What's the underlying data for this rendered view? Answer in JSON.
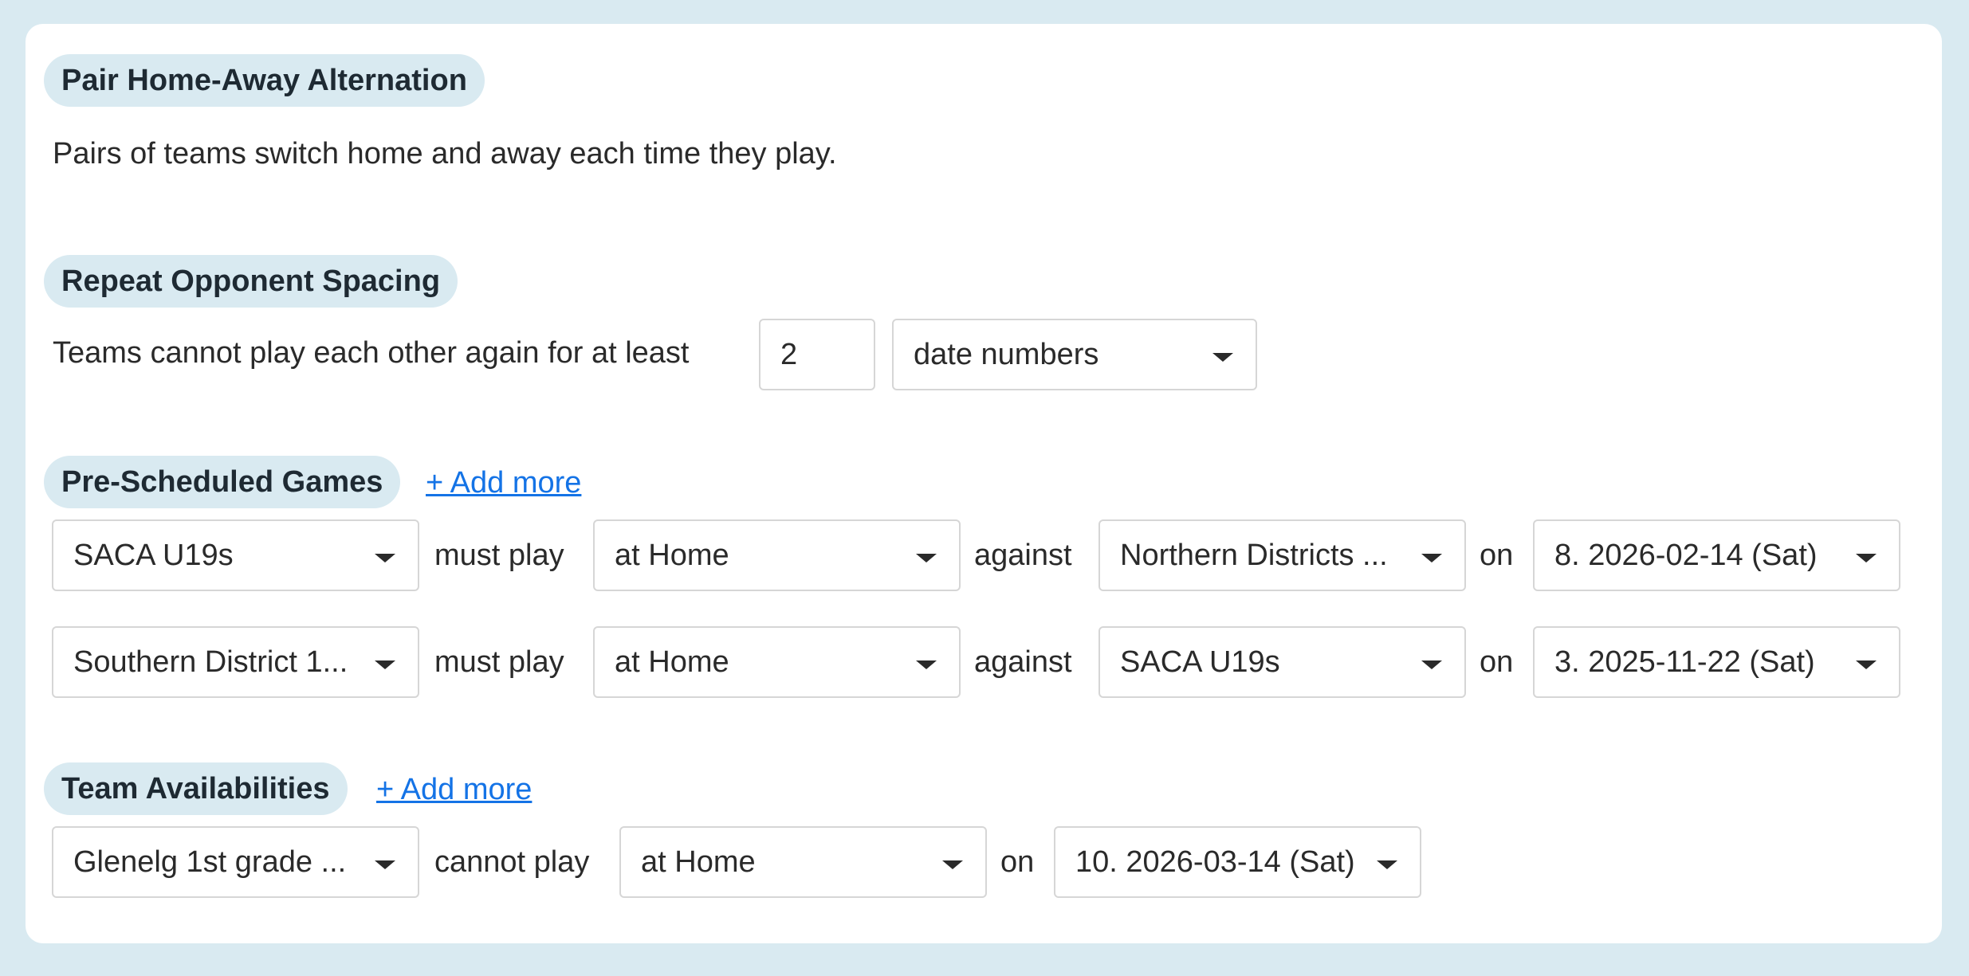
{
  "sections": {
    "alternation": {
      "title": "Pair Home-Away Alternation",
      "description": "Pairs of teams switch home and away each time they play."
    },
    "spacing": {
      "title": "Repeat Opponent Spacing",
      "text": "Teams cannot play each other again for at least",
      "value": "2",
      "unit": "date numbers"
    },
    "prescheduled": {
      "title": "Pre-Scheduled Games",
      "add_more": "+ Add more",
      "rows": [
        {
          "team": "SACA U19s",
          "must_play": "must play",
          "venue": "at Home",
          "against": "against",
          "opponent": "Northern Districts ...",
          "on": "on",
          "date": "8. 2026-02-14 (Sat)"
        },
        {
          "team": "Southern District 1...",
          "must_play": "must play",
          "venue": "at Home",
          "against": "against",
          "opponent": "SACA U19s",
          "on": "on",
          "date": "3. 2025-11-22 (Sat)"
        }
      ]
    },
    "availabilities": {
      "title": "Team Availabilities",
      "add_more": "+ Add more",
      "rows": [
        {
          "team": "Glenelg 1st grade ...",
          "cannot_play": "cannot play",
          "venue": "at Home",
          "on": "on",
          "date": "10. 2026-03-14 (Sat)"
        }
      ]
    }
  },
  "icons": {
    "dropdown": "chevron-down-icon"
  },
  "colors": {
    "background": "#d9eaf1",
    "pill": "#d9eaf1",
    "link": "#1473e6"
  }
}
